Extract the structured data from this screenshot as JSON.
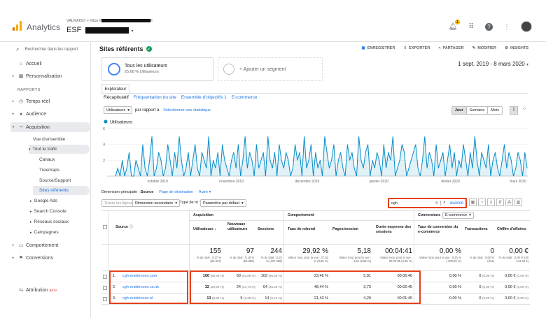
{
  "app": {
    "title": "Analytics",
    "account_crumb": "VALRAISO > https://",
    "account_crumb_suffix": "fr",
    "property": "ESF"
  },
  "topbar": {
    "notification_count": "1"
  },
  "sidebar": {
    "search_placeholder": "Rechercher dans les rapport",
    "items": [
      {
        "label": "Accueil"
      },
      {
        "label": "Personnalisation"
      },
      {
        "section": "RAPPORTS"
      },
      {
        "label": "Temps réel"
      },
      {
        "label": "Audience"
      },
      {
        "label": "Acquisition"
      },
      {
        "label": "Comportement"
      },
      {
        "label": "Conversions"
      }
    ],
    "acquisition_sub": [
      "Vue d'ensemble",
      "Tout le trafic",
      "Canaux",
      "Treemaps",
      "Source/Support",
      "Sites référents",
      "Google Ads",
      "Search Console",
      "Réseaux sociaux",
      "Campagnes"
    ],
    "attribution": "Attribution",
    "attribution_badge": "BETA"
  },
  "header": {
    "title": "Sites référents",
    "actions": [
      "ENREGISTRER",
      "EXPORTER",
      "PARTAGER",
      "MODIFIER",
      "INSIGHTS"
    ],
    "date_range": "1 sept. 2019 - 8 mars 2020"
  },
  "segments": {
    "current_title": "Tous les utilisateurs",
    "current_sub": "25,68 % Utilisateurs",
    "add_label": "+ Ajouter un segment"
  },
  "explorer": {
    "tab": "Explorateur",
    "subtabs": [
      "Récapitulatif",
      "Fréquentation du site",
      "Ensemble d'objectifs 1",
      "E-commerce"
    ]
  },
  "chart_controls": {
    "metric": "Utilisateurs",
    "compare": "par rapport à",
    "select_stat": "Sélectionner une statistique",
    "granularity": [
      "Jour",
      "Semaine",
      "Mois"
    ],
    "selected_granularity": "Jour"
  },
  "chart_data": {
    "type": "line",
    "series": [
      {
        "name": "Utilisateurs",
        "values": [
          0,
          1,
          0,
          2,
          0,
          1,
          3,
          0,
          0,
          2,
          1,
          0,
          4,
          1,
          0,
          2,
          5,
          0,
          1,
          3,
          2,
          0,
          1,
          4,
          2,
          0,
          3,
          1,
          5,
          2,
          0,
          1,
          3,
          0,
          2,
          4,
          1,
          0,
          3,
          2,
          1,
          5,
          0,
          2,
          1,
          3,
          0,
          4,
          2,
          1,
          0,
          2,
          3,
          1,
          4,
          0,
          2,
          5,
          1,
          3,
          2,
          0,
          4,
          1,
          2,
          3,
          0,
          5,
          2,
          1,
          3,
          0,
          4,
          2,
          1,
          3,
          2,
          0,
          1,
          4,
          2,
          3,
          0,
          5,
          1,
          2,
          4,
          0,
          3,
          1,
          2,
          0,
          5,
          3,
          1,
          2,
          4,
          0,
          2,
          3,
          1,
          0,
          4,
          2,
          3,
          1,
          0,
          5,
          2,
          1,
          3,
          4,
          0,
          2,
          1,
          3,
          2,
          0,
          4,
          1,
          3,
          2,
          5,
          0,
          1,
          2,
          4,
          3,
          0,
          1,
          2,
          3,
          4,
          1,
          0,
          2,
          5,
          1,
          3,
          2,
          0,
          4,
          1,
          2,
          3,
          0,
          2,
          4,
          1,
          3,
          0,
          2,
          1,
          4,
          2,
          0,
          3,
          1,
          5,
          2,
          0,
          3,
          2,
          1,
          4,
          0,
          2,
          3,
          1,
          0,
          2,
          4,
          1,
          3,
          2,
          0,
          1,
          3,
          2,
          0,
          3,
          1
        ]
      }
    ],
    "x_ticks": [
      "octobre 2019",
      "novembre 2019",
      "décembre 2019",
      "janvier 2020",
      "février 2020",
      "mars 2020"
    ],
    "ylim": [
      0,
      6
    ],
    "y_ticks": [
      "2",
      "4",
      "6"
    ],
    "grid": true
  },
  "dimension": {
    "label": "Dimension principale :",
    "selected": "Source",
    "others": [
      "Page de destination",
      "Autre"
    ]
  },
  "table_controls": {
    "plot_rows": "Tracer les lignes",
    "secondary": "Dimension secondaire",
    "sort_type": "Type de tri :",
    "sort_value": "Paramètre par défaut",
    "search_value": "cgh",
    "advanced": "avancé"
  },
  "table": {
    "groups": [
      "Acquisition",
      "Comportement",
      "Conversions"
    ],
    "conversions_select": "E-commerce",
    "headers": [
      "Source",
      "Utilisateurs",
      "Nouveaux utilisateurs",
      "Sessions",
      "Taux de rebond",
      "Pages/session",
      "Durée moyenne des sessions",
      "Taux de conversion du e-commerce",
      "Transactions",
      "Chiffre d'affaires"
    ],
    "totals": [
      {
        "value": "155",
        "sub": "% du total : 0,27 % (55 827)"
      },
      {
        "value": "97",
        "sub": "% du total : 0,18 % (53 080)"
      },
      {
        "value": "244",
        "sub": "% du total : 0,23 % (107 666)"
      },
      {
        "value": "29,92 %",
        "sub": "Valeur moy. pour la vue : 27,53 % (8,69 %)"
      },
      {
        "value": "5,18",
        "sub": "Valeur moy. pour la vue : 4,91 (5,59 %)"
      },
      {
        "value": "00:04:41",
        "sub": "Valeur moy. pour la vue : 00:04:35 (4,05 %)"
      },
      {
        "value": "0,00 %",
        "sub": "Valeur moy. pour la vue : 0,21 % (-100,00 %)"
      },
      {
        "value": "0",
        "sub": "% du total : 0,00 % (321)"
      },
      {
        "value": "0,00 €",
        "sub": "% du total : 0,00 % (40 144,34 €)"
      }
    ],
    "rows": [
      {
        "idx": "1.",
        "source": "cgh-residences.com",
        "users": "106",
        "users_pct": "(68,39 %)",
        "new": "60",
        "new_pct": "(61,86 %)",
        "sessions": "162",
        "sessions_pct": "(66,39 %)",
        "bounce": "23,46 %",
        "pages": "5,91",
        "duration": "00:05:46",
        "conv": "0,00 %",
        "trans": "0",
        "trans_pct": "(0,00 %)",
        "revenue": "0,00 €",
        "revenue_pct": "(0,00 %)"
      },
      {
        "idx": "2.",
        "source": "cgh-residences.co.uk",
        "users": "32",
        "users_pct": "(20,65 %)",
        "new": "24",
        "new_pct": "(24,74 %)",
        "sessions": "64",
        "sessions_pct": "(26,23 %)",
        "bounce": "48,44 %",
        "pages": "3,73",
        "duration": "00:02:45",
        "conv": "0,00 %",
        "trans": "0",
        "trans_pct": "(0,00 %)",
        "revenue": "0,00 €",
        "revenue_pct": "(0,00 %)"
      },
      {
        "idx": "3.",
        "source": "cgh-residences.nl",
        "users": "13",
        "users_pct": "(8,39 %)",
        "new": "9",
        "new_pct": "(9,28 %)",
        "sessions": "14",
        "sessions_pct": "(5,74 %)",
        "bounce": "21,43 %",
        "pages": "4,29",
        "duration": "00:01:40",
        "conv": "0,00 %",
        "trans": "0",
        "trans_pct": "(0,00 %)",
        "revenue": "0,00 €",
        "revenue_pct": "(0,00 %)"
      }
    ]
  },
  "colors": {
    "accent": "#1a73e8",
    "series": "#058dc7",
    "highlight": "#e4401b",
    "logo_orange": "#f9ab00",
    "logo_dark": "#e37400"
  }
}
